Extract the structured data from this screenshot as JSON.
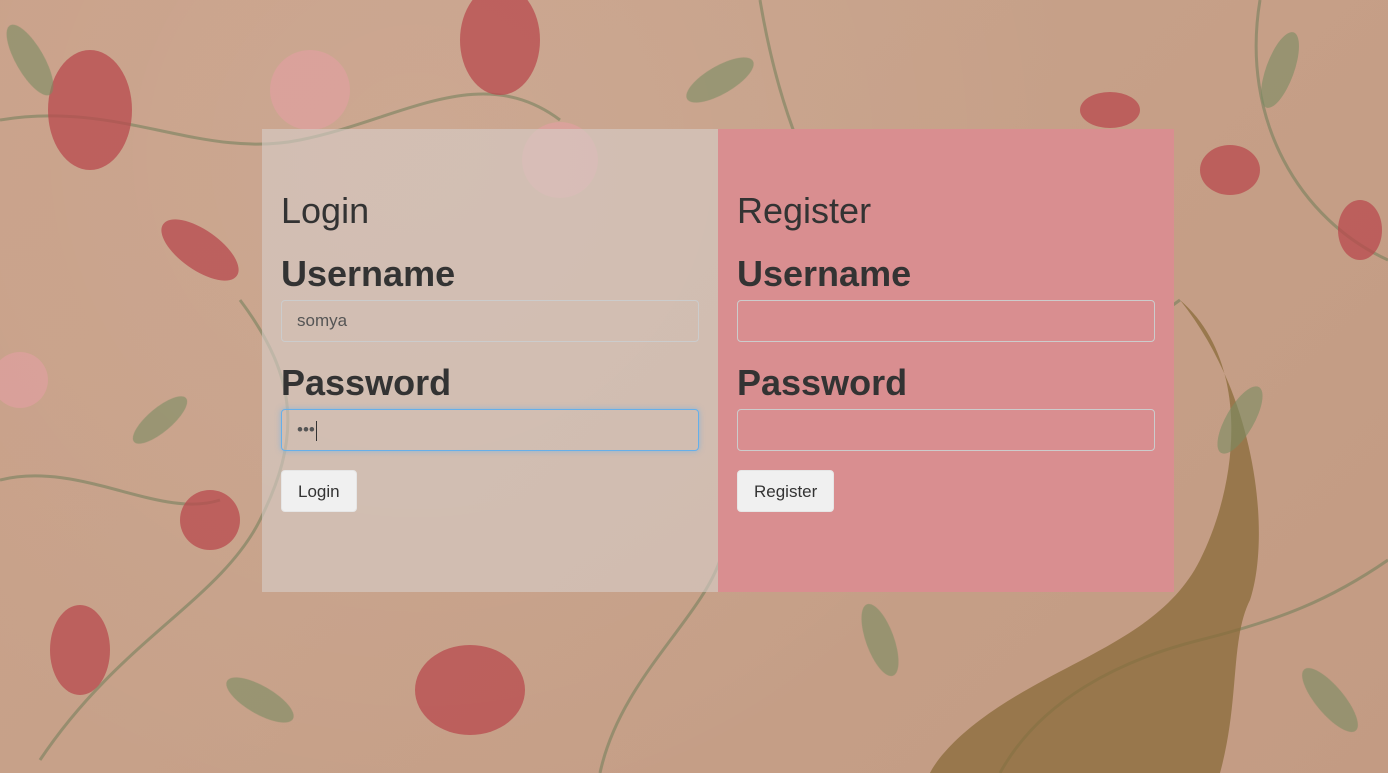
{
  "login": {
    "title": "Login",
    "username_label": "Username",
    "username_value": "somya",
    "password_label": "Password",
    "password_value": "•••",
    "button_label": "Login"
  },
  "register": {
    "title": "Register",
    "username_label": "Username",
    "username_value": "",
    "password_label": "Password",
    "password_value": "",
    "button_label": "Register"
  },
  "colors": {
    "register_panel": "#d98e90",
    "login_panel": "#d6cdc8",
    "background": "#c9a088",
    "focus_border": "#66afe9"
  }
}
